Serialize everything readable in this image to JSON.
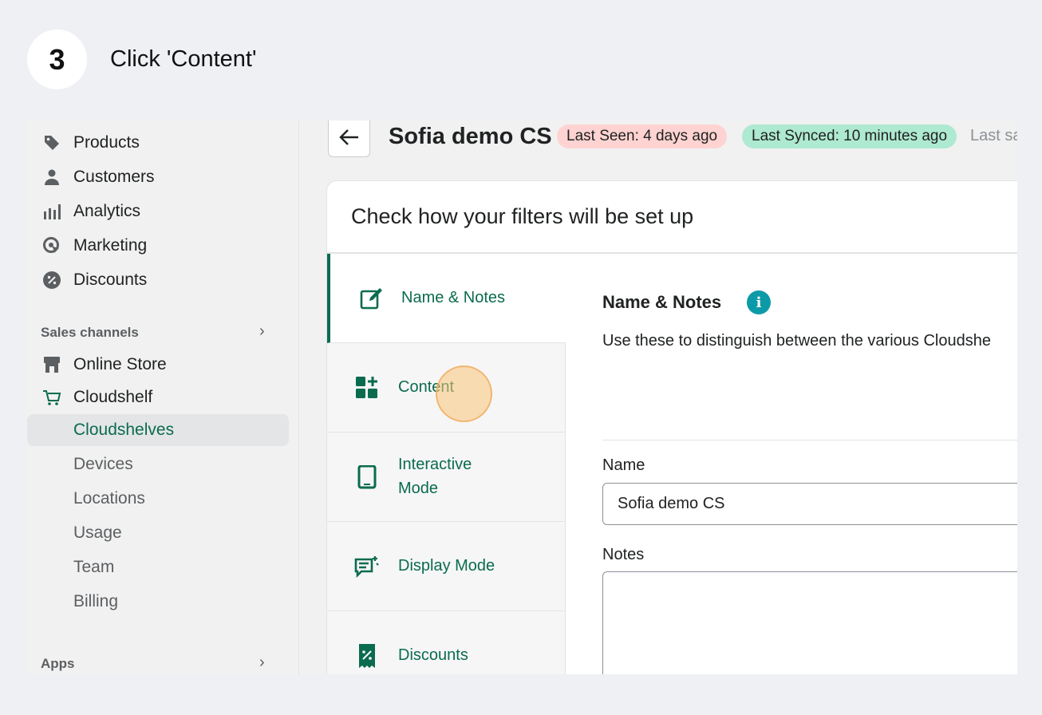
{
  "step": {
    "number": "3",
    "instruction": "Click 'Content'"
  },
  "sidebar": {
    "items": [
      {
        "label": "Products",
        "icon": "tag-icon"
      },
      {
        "label": "Customers",
        "icon": "person-icon"
      },
      {
        "label": "Analytics",
        "icon": "bar-chart-icon"
      },
      {
        "label": "Marketing",
        "icon": "target-icon"
      },
      {
        "label": "Discounts",
        "icon": "discount-icon"
      }
    ],
    "sales_channels_label": "Sales channels",
    "online_store_label": "Online Store",
    "cloudshelf_label": "Cloudshelf",
    "subitems": [
      "Cloudshelves",
      "Devices",
      "Locations",
      "Usage",
      "Team",
      "Billing"
    ],
    "active_subitem": "Cloudshelves",
    "apps_label": "Apps"
  },
  "header": {
    "title": "Sofia demo CS",
    "last_seen": "Last Seen: 4 days ago",
    "last_synced": "Last Synced: 10 minutes ago",
    "last_saved_partial": "Last sa"
  },
  "card": {
    "title": "Check how your filters will be set up",
    "tabs": [
      {
        "label": "Name & Notes",
        "icon": "edit-icon"
      },
      {
        "label": "Content",
        "icon": "grid-plus-icon"
      },
      {
        "label_line1": "Interactive",
        "label_line2": "Mode",
        "icon": "tablet-icon"
      },
      {
        "label": "Display Mode",
        "icon": "chat-sparkle-icon"
      },
      {
        "label": "Discounts",
        "icon": "receipt-discount-icon"
      }
    ],
    "active_tab": "Name & Notes",
    "panel": {
      "heading": "Name & Notes",
      "description": "Use these to distinguish between the various Cloudshe",
      "name_label": "Name",
      "name_value": "Sofia demo CS",
      "notes_label": "Notes",
      "notes_value": ""
    }
  },
  "colors": {
    "accent": "#0b6b4e",
    "badge_seen": "#fed3d1",
    "badge_synced": "#aee9d1",
    "info": "#0d9aa8",
    "click_highlight": "#f9c47a"
  }
}
